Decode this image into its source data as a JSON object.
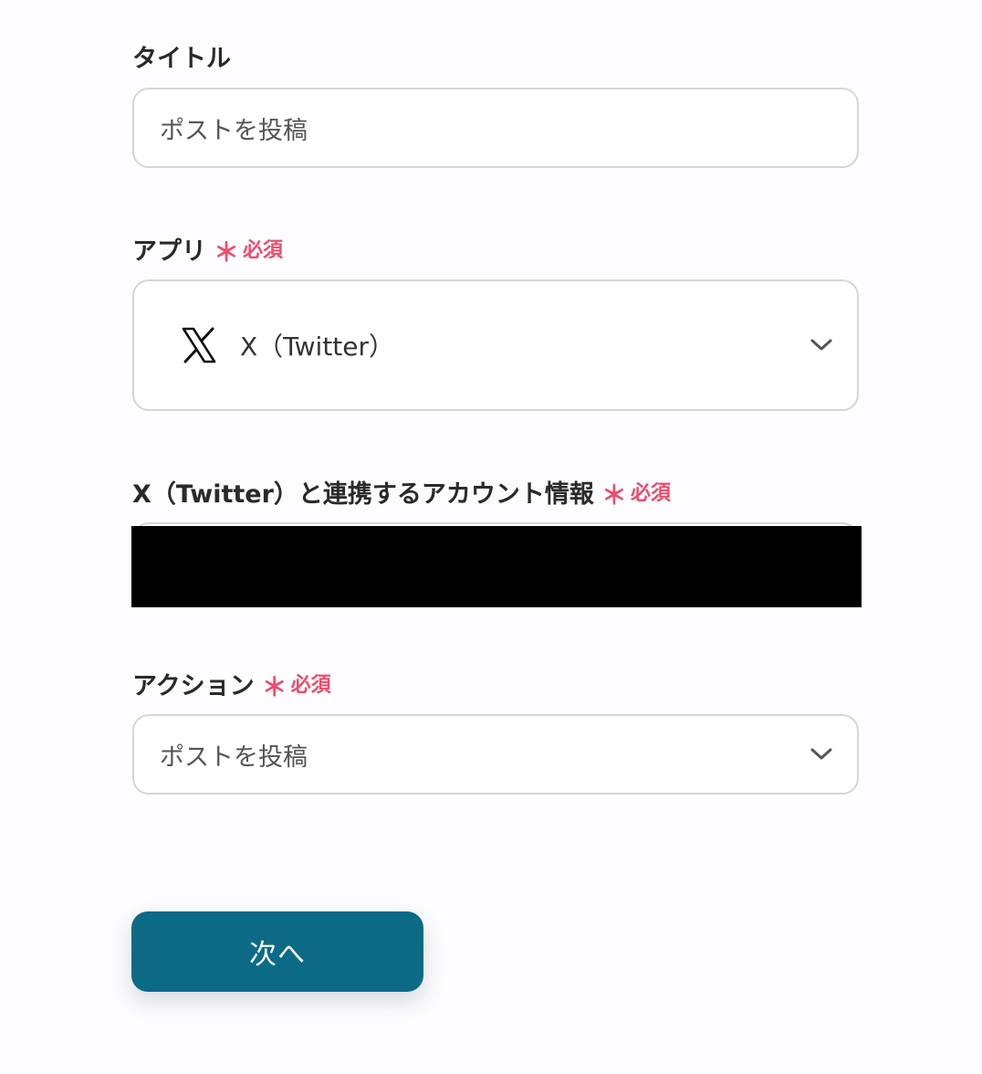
{
  "title_field": {
    "label": "タイトル",
    "value": "ポストを投稿"
  },
  "app_field": {
    "label": "アプリ",
    "required_mark": "＊",
    "required_text": "必須",
    "value": "X（Twitter）",
    "icon": "x-logo-icon"
  },
  "account_field": {
    "label": "X（Twitter）と連携するアカウント情報",
    "required_mark": "＊",
    "required_text": "必須"
  },
  "action_field": {
    "label": "アクション",
    "required_mark": "＊",
    "required_text": "必須",
    "value": "ポストを投稿"
  },
  "next_button": {
    "label": "次へ"
  },
  "colors": {
    "accent": "#0c6a86",
    "required": "#f04b6b",
    "border": "#d6d4dc"
  }
}
